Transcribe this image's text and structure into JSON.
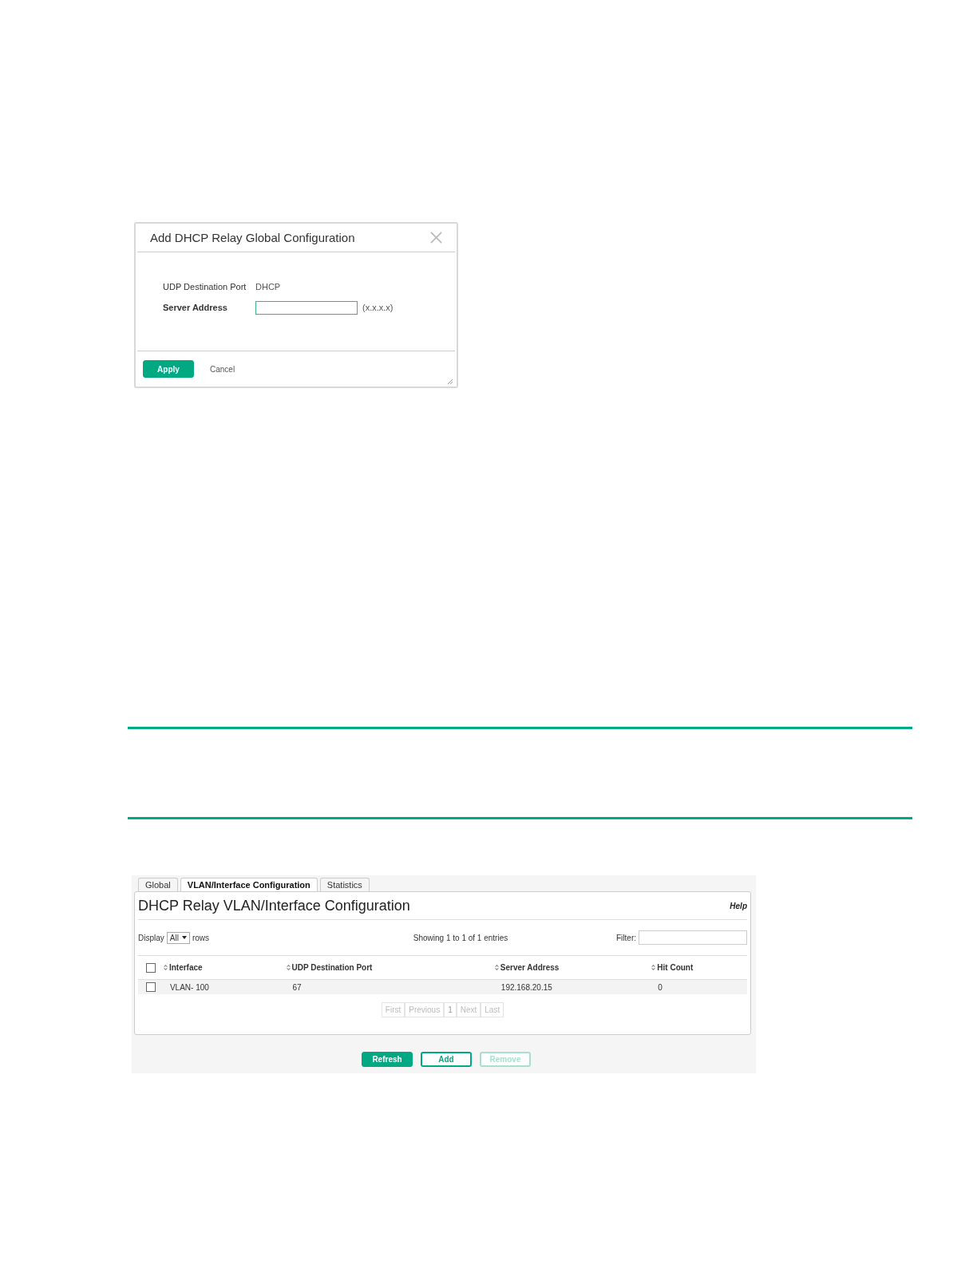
{
  "dialog": {
    "title": "Add DHCP Relay Global Configuration",
    "fields": [
      {
        "kind": "text",
        "label": "UDP Destination Port",
        "value": "DHCP"
      },
      {
        "kind": "input",
        "label": "Server Address",
        "hint": "(x.x.x.x)"
      }
    ],
    "buttons": [
      {
        "kind": "primary",
        "label": "Apply"
      },
      {
        "kind": "link",
        "label": "Cancel"
      }
    ]
  },
  "panel": {
    "tabs": [
      {
        "label": "Global",
        "selected": false
      },
      {
        "label": "VLAN/Interface Configuration",
        "selected": true
      },
      {
        "label": "Statistics",
        "selected": false
      }
    ],
    "title": "DHCP Relay VLAN/Interface Configuration",
    "help": "Help",
    "display_label": "Display",
    "rows_select": "All",
    "rows_label": "rows",
    "info": "Showing 1 to 1 of 1 entries",
    "filter_label": "Filter:",
    "table": {
      "header_checked": false,
      "columns": [
        "Interface",
        "UDP Destination Port",
        "Server Address",
        "Hit Count"
      ],
      "rows": [
        {
          "checked": false,
          "cells": [
            "VLAN- 100",
            "67",
            "192.168.20.15",
            "0"
          ]
        }
      ]
    },
    "pagination": [
      {
        "label": "First",
        "disabled": true
      },
      {
        "label": "Previous",
        "disabled": true
      },
      {
        "label": "1",
        "disabled": false
      },
      {
        "label": "Next",
        "disabled": true
      },
      {
        "label": "Last",
        "disabled": true
      }
    ],
    "buttons": [
      {
        "kind": "primary",
        "label": "Refresh",
        "disabled": false
      },
      {
        "kind": "outline",
        "label": "Add",
        "disabled": false
      },
      {
        "kind": "outline",
        "label": "Remove",
        "disabled": true
      }
    ]
  }
}
